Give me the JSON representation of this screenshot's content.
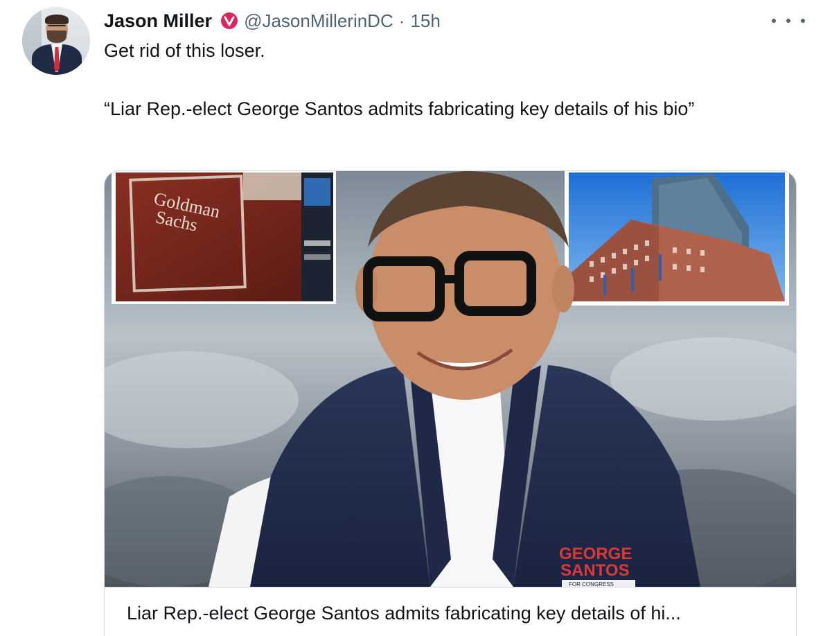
{
  "tweet": {
    "author_name": "Jason Miller",
    "author_handle": "@JasonMillerinDC",
    "separator": "·",
    "timestamp": "15h",
    "body_line1": "Get rid of this loser.",
    "body_line2": "“Liar Rep.-elect George Santos admits fabricating key details of his bio”"
  },
  "card": {
    "caption": "Liar Rep.-elect George Santos admits fabricating key details of hi...",
    "image": {
      "left_inset_sign_line1": "Goldman",
      "left_inset_sign_line2": "Sachs",
      "vest_logo_line1": "GEORGE",
      "vest_logo_line2": "SANTOS",
      "vest_logo_line3": "FOR CONGRESS"
    }
  },
  "icons": {
    "verified": "verified-badge-icon",
    "more": "more-options-icon"
  },
  "colors": {
    "text_primary": "#0f1419",
    "text_secondary": "#536471",
    "verified_badge": "#e0245e",
    "card_border": "#cfd9de"
  }
}
